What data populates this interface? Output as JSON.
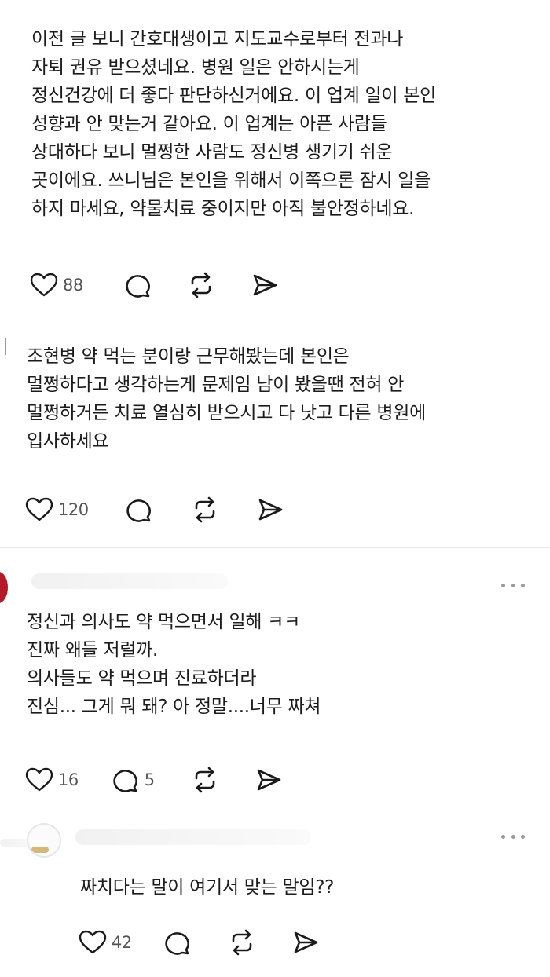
{
  "posts": [
    {
      "lines": [
        "이전 글 보니 간호대생이고 지도교수로부터 전과나",
        "자퇴 권유 받으셨네요. 병원 일은 안하시는게",
        "정신건강에 더 좋다 판단하신거에요. 이 업계 일이 본인",
        "성향과 안 맞는거 같아요. 이 업계는 아픈 사람들",
        "상대하다 보니 멀쩡한 사람도 정신병 생기기 쉬운",
        "곳이에요. 쓰니님은 본인을 위해서 이쪽으론 잠시 일을",
        "하지 마세요, 약물치료 중이지만 아직 불안정하네요."
      ],
      "likes": "88",
      "replies": ""
    },
    {
      "lines": [
        "조현병 약 먹는 분이랑 근무해봤는데 본인은",
        "멀쩡하다고 생각하는게 문제임 남이 봤을땐 전혀 안",
        "멀쩡하거든 치료 열심히 받으시고 다 낫고 다른 병원에",
        "입사하세요"
      ],
      "likes": "120",
      "replies": ""
    },
    {
      "lines": [
        "정신과 의사도 약 먹으면서 일해 ㅋㅋ",
        "진짜 왜들 저럴까.",
        "의사들도 약 먹으며 진료하더라",
        "진심... 그게 뭐 돼? 아 정말....너무 짜쳐"
      ],
      "likes": "16",
      "replies": "5"
    },
    {
      "lines": [
        "짜치다는 말이 여기서 맞는 말임??"
      ],
      "likes": "42",
      "replies": ""
    }
  ],
  "icons": {
    "like": "heart-icon",
    "reply": "comment-icon",
    "repost": "repost-icon",
    "share": "send-icon"
  },
  "colors": {
    "text": "#1c1c1c",
    "icon": "#1a1a1a",
    "count": "#555555",
    "divider": "#e8e8e8",
    "avatar": "#b51a2a"
  }
}
